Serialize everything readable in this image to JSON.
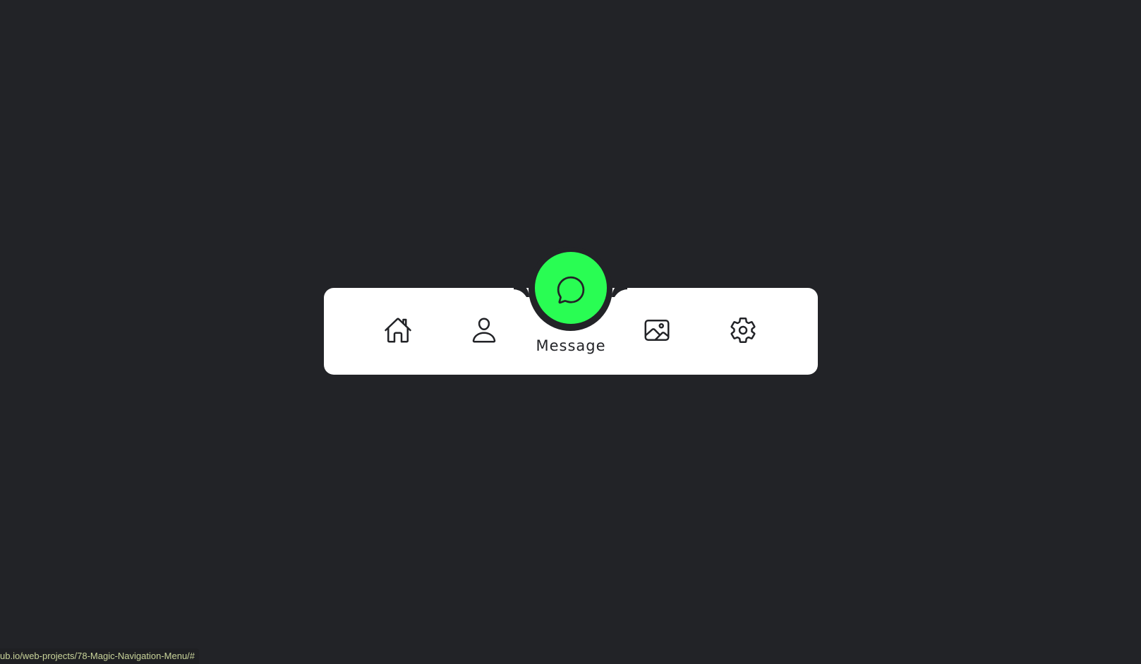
{
  "navigation": {
    "items": [
      {
        "label": "Home",
        "icon": "home-icon",
        "active": false
      },
      {
        "label": "Profile",
        "icon": "person-icon",
        "active": false
      },
      {
        "label": "Message",
        "icon": "chat-icon",
        "active": true
      },
      {
        "label": "Photos",
        "icon": "image-icon",
        "active": false
      },
      {
        "label": "Settings",
        "icon": "gear-icon",
        "active": false
      }
    ],
    "active_label": "Message"
  },
  "status_bar": {
    "url": "ub.io/web-projects/78-Magic-Navigation-Menu/#"
  },
  "colors": {
    "background": "#222327",
    "nav_background": "#ffffff",
    "accent": "#29fd53",
    "icon": "#222327"
  }
}
